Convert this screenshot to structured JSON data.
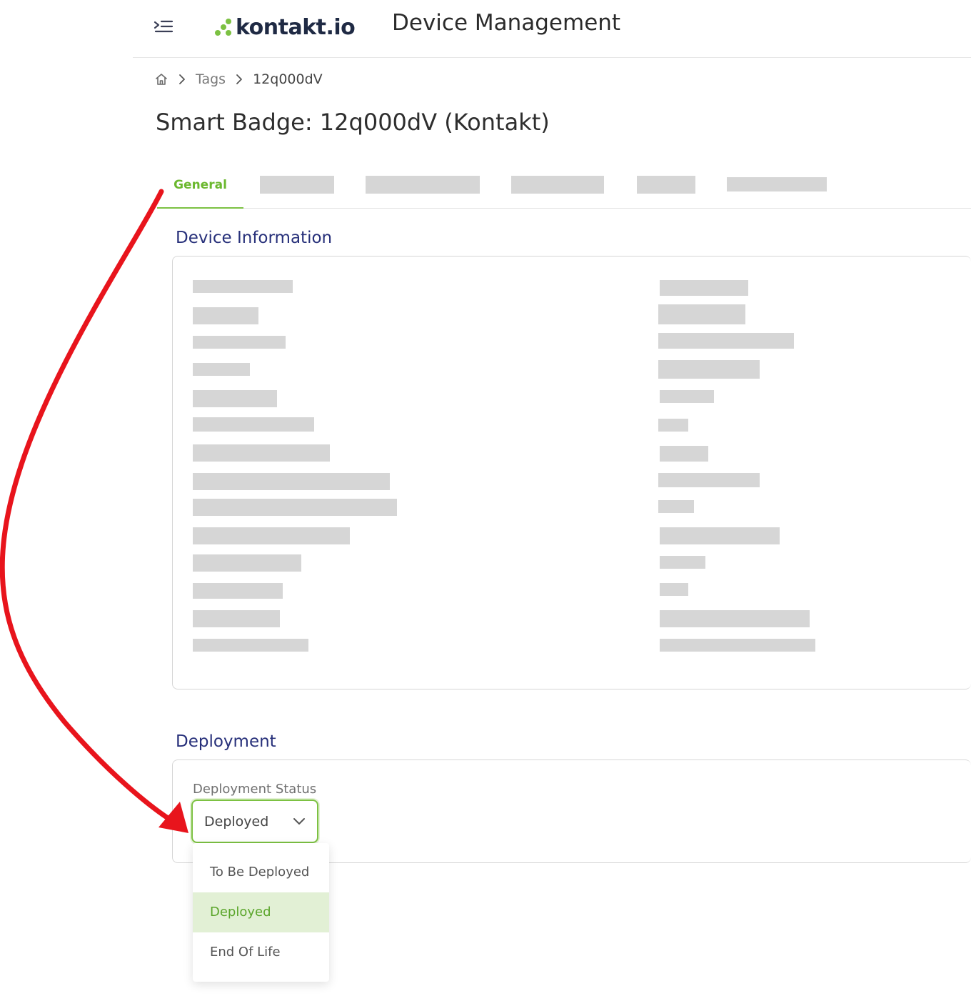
{
  "header": {
    "logo_text": "kontakt.io",
    "app_title": "Device Management"
  },
  "breadcrumb": {
    "items": [
      "Tags",
      "12q000dV"
    ]
  },
  "page": {
    "title": "Smart Badge: 12q000dV (Kontakt)"
  },
  "tabs": {
    "active_label": "General"
  },
  "sections": {
    "device_information": {
      "title": "Device Information"
    },
    "deployment": {
      "title": "Deployment",
      "status_label": "Deployment Status",
      "status_value": "Deployed",
      "options": [
        "To Be Deployed",
        "Deployed",
        "End Of Life"
      ],
      "selected_option": "Deployed"
    }
  },
  "colors": {
    "accent_green": "#7cc142",
    "section_title_blue": "#27307a",
    "annotation_arrow_red": "#e8141c"
  },
  "icons": [
    "menu-icon",
    "home-icon",
    "chevron-right-icon",
    "chevron-down-icon"
  ]
}
